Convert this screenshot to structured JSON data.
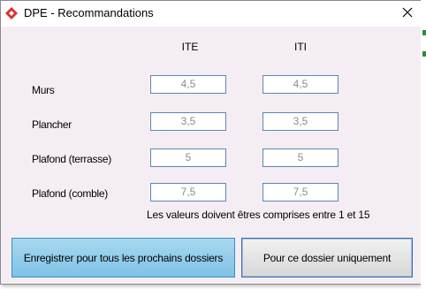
{
  "window": {
    "title": "DPE - Recommandations",
    "app_icon": "red-diamond-icon",
    "close_icon": "close-icon"
  },
  "columns": {
    "ite": "ITE",
    "iti": "ITI"
  },
  "rows": [
    {
      "label": "Murs",
      "ite": "4,5",
      "iti": "4,5"
    },
    {
      "label": "Plancher",
      "ite": "3,5",
      "iti": "3,5"
    },
    {
      "label": "Plafond (terrasse)",
      "ite": "5",
      "iti": "5"
    },
    {
      "label": "Plafond (comble)",
      "ite": "7,5",
      "iti": "7,5"
    }
  ],
  "hint": "Les valeurs doivent êtres comprises entre 1 et 15",
  "buttons": {
    "save_all": "Enregistrer pour tous les prochains dossiers",
    "this_only": "Pour ce dossier uniquement"
  },
  "colors": {
    "window_bg": "#f4eef4",
    "field_border": "#5b87ad",
    "primary_button": "#7fc2e6",
    "app_icon": "#d9302b"
  }
}
